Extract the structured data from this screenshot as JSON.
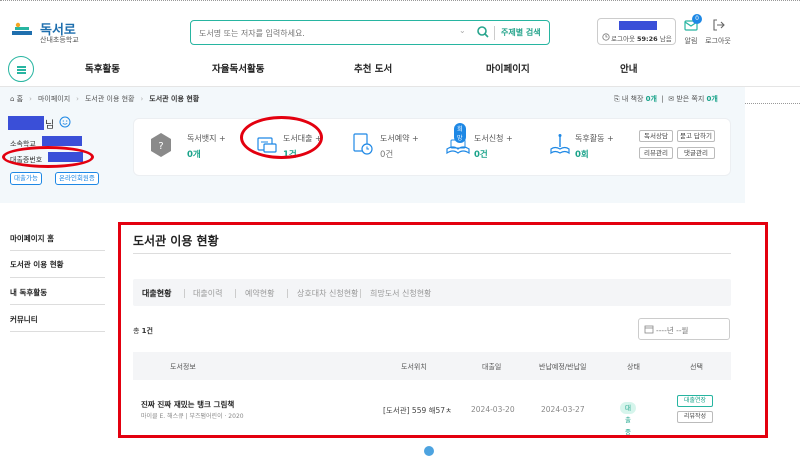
{
  "header": {
    "logo_title": "독서로",
    "logo_subtitle": "산내초등학교",
    "search_placeholder": "도서명 또는 저자를 입력하세요.",
    "advanced_search": "주제별 검색",
    "logout_timer_label": "로그아웃",
    "logout_timer_value": "59:26",
    "logout_timer_suffix": "남음",
    "alarm_label": "알림",
    "alarm_count": "0",
    "logout_label": "로그아웃"
  },
  "nav": [
    "독후활동",
    "자율독서활동",
    "추천 도서",
    "마이페이지",
    "안내"
  ],
  "breadcrumb": {
    "home": "홈",
    "items": [
      "마이페이지",
      "도서관 이용 현황"
    ],
    "current": "도서관 이용 현황"
  },
  "side_links": {
    "bookshelf_label": "내 책장",
    "bookshelf_count": "0개",
    "notes_label": "받은 쪽지",
    "notes_count": "0개"
  },
  "profile": {
    "suffix": "님",
    "school_label": "소속학교",
    "card_label": "대출증번호",
    "btn_loan": "대출가능",
    "btn_online": "온라인회원증"
  },
  "stats": [
    {
      "label": "독서뱃지 +",
      "value": "0개"
    },
    {
      "label": "도서대출 +",
      "value": "1건"
    },
    {
      "label": "도서예약 +",
      "value": "0건"
    },
    {
      "label": "도서신청 +",
      "value": "0건",
      "badge": "희망"
    },
    {
      "label": "독후활동 +",
      "value": "0회"
    }
  ],
  "stat_tags": [
    "독서상담",
    "묻고 답하기",
    "리뷰관리",
    "댓글관리"
  ],
  "sidebar": [
    "마이페이지 홈",
    "도서관 이용 현황",
    "내 독후활동",
    "커뮤니티"
  ],
  "main": {
    "title": "도서관 이용 현황",
    "tabs": [
      "대출현황",
      "대출이력",
      "예약현황",
      "상호대차 신청현황",
      "희망도서 신청현황"
    ],
    "total_prefix": "총 ",
    "total_count": "1건",
    "date_placeholder": "----년 --월",
    "columns": [
      "도서정보",
      "도서위치",
      "대출일",
      "반납예정/반납일",
      "상태",
      "선택"
    ],
    "rows": [
      {
        "title": "진짜 진짜 재밌는 탱크 그림책",
        "meta": "마이클 E. 해스큐  |  부즈펌어린이 · 2020",
        "location": "[도서관] 559 해57ㅊ",
        "loan_date": "2024-03-20",
        "return_date": "2024-03-27",
        "status": "대출중",
        "actions": [
          "대출연장",
          "리뷰작성"
        ]
      }
    ]
  }
}
